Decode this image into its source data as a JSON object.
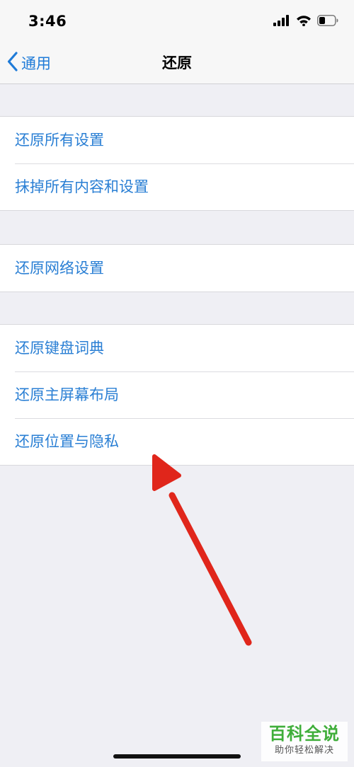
{
  "status_bar": {
    "time": "3:46",
    "icons": [
      "cellular-signal-icon",
      "wifi-icon",
      "battery-icon"
    ]
  },
  "navbar": {
    "back_label": "通用",
    "title": "还原"
  },
  "groups": [
    {
      "items": [
        "还原所有设置",
        "抹掉所有内容和设置"
      ]
    },
    {
      "items": [
        "还原网络设置"
      ]
    },
    {
      "items": [
        "还原键盘词典",
        "还原主屏幕布局",
        "还原位置与隐私"
      ]
    }
  ],
  "annotation": {
    "type": "arrow",
    "color": "#e0261b",
    "points_to": "还原位置与隐私"
  },
  "watermark": {
    "title": "百科全说",
    "subtitle": "助你轻松解决"
  },
  "colors": {
    "accent": "#2a7fd4",
    "background": "#efeff4"
  }
}
